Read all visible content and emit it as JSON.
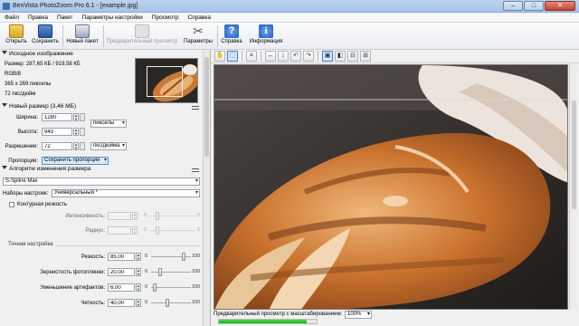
{
  "window": {
    "title": "BenVista PhotoZoom Pro 6.1 - [example.jpg]"
  },
  "window_buttons": {
    "minimize": "–",
    "maximize": "□",
    "close": "✕"
  },
  "menu": [
    "Файл",
    "Правка",
    "Пакет",
    "Параметры настройки",
    "Просмотр",
    "Справка"
  ],
  "toolbar": {
    "open": "Открыть",
    "save": "Сохранить",
    "new_batch": "Новый пакет",
    "preview": "Предварительный просмотр",
    "params": "Параметры",
    "help": "Справка",
    "info": "Информация",
    "help_glyph": "?",
    "info_glyph": "i",
    "params_glyph": "✂"
  },
  "icons": {
    "open": "folder-icon",
    "save": "save-icon",
    "new_batch": "batch-icon",
    "preview": "preview-icon",
    "params": "tools-icon",
    "help": "help-icon",
    "info": "info-icon"
  },
  "source": {
    "header": "Исходное изображение",
    "size": "Размер: 287,65 КБ / 919,58 КБ",
    "mode": "RGB/8",
    "dims": "365 x 269 пикселы",
    "res": "72 пкс/дюйм"
  },
  "new_size": {
    "header": "Новый размер (3,46 МБ)",
    "width_label": "Ширина:",
    "width_value": "1280",
    "height_label": "Высота:",
    "height_value": "943",
    "unit": "пикселы",
    "resolution_label": "Разрешение:",
    "resolution_value": "72",
    "resolution_unit": "пкс/дюйма",
    "proportions_label": "Пропорции:",
    "proportions_value": "Сохранить пропорции"
  },
  "resize": {
    "header": "Алгоритм изменения размера",
    "method": "S-Spline Max",
    "presets_label": "Наборы настроек:",
    "presets_value": "Универсальный *",
    "contour_label": "Контурная резкость",
    "intensity_label": "Интенсивность:",
    "intensity_min": "0",
    "intensity_max": "5",
    "radius_label": "Радиус:",
    "radius_min": "0",
    "radius_max": "5",
    "fine_title": "Точная настройка",
    "sharpness_label": "Резкость:",
    "sharpness_value": "85,00",
    "sharpness_min": "0",
    "sharpness_max": "100",
    "sharpness_level": 0.85,
    "grain_label": "Зернистость фотопленки:",
    "grain_value": "20,00",
    "grain_min": "0",
    "grain_max": "100",
    "grain_level": 0.2,
    "artifact_label": "Уменьшение артефактов:",
    "artifact_value": "6,00",
    "artifact_min": "0",
    "artifact_max": "100",
    "artifact_level": 0.06,
    "clarity_label": "Четкость:",
    "clarity_value": "40,00",
    "clarity_min": "0",
    "clarity_max": "100",
    "clarity_level": 0.4
  },
  "preview": {
    "status": "Предварительный просмотр с масштабированием:",
    "zoom": "100%",
    "progress": 0.9
  }
}
